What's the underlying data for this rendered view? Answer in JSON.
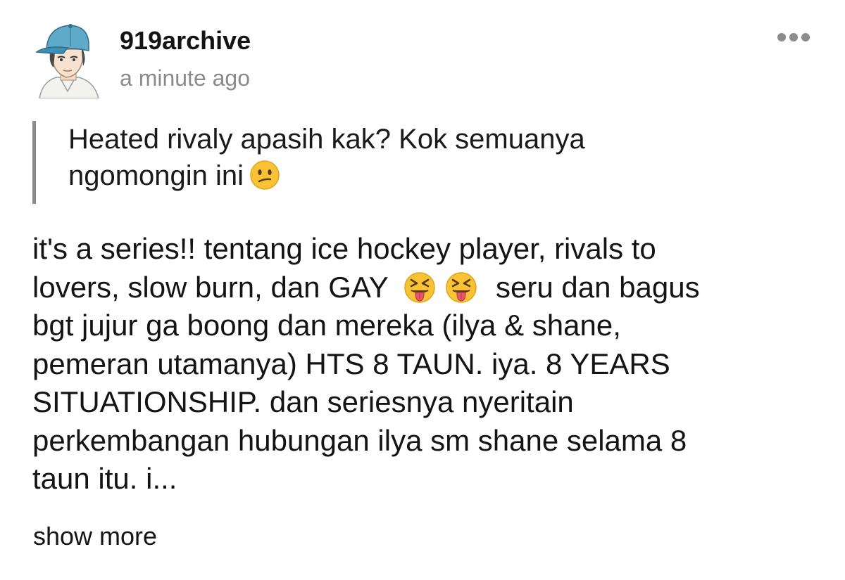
{
  "post": {
    "author": {
      "username": "919archive",
      "avatar_icon": "avatar-cap-boy-icon"
    },
    "timestamp": "a minute ago",
    "more_icon": "more-dots-icon",
    "quote": {
      "text": "Heated rivaly apasih kak? Kok semuanya ngomongin ini",
      "lines": [
        "Heated rivaly apasih kak? Kok semuanya",
        "ngomongin ini"
      ],
      "emoji": "confused-face-icon"
    },
    "body": {
      "lines": [
        "it's a series!! tentang ice hockey player, rivals to",
        "lovers, slow burn, dan GAY",
        "seru dan bagus",
        "bgt jujur ga boong dan mereka (ilya & shane,",
        "pemeran utamanya) HTS 8 TAUN. iya. 8 YEARS",
        "SITUATIONSHIP. dan seriesnya nyeritain",
        "perkembangan hubungan ilya sm shane selama 8",
        "taun itu. i..."
      ],
      "emoji": "squinting-face-with-tongue-icon"
    },
    "show_more_label": "show more"
  },
  "colors": {
    "text": "#141414",
    "muted": "#8a8a8a",
    "quote_border": "#8c8c8c",
    "emoji_yellow": "#f7c234"
  }
}
